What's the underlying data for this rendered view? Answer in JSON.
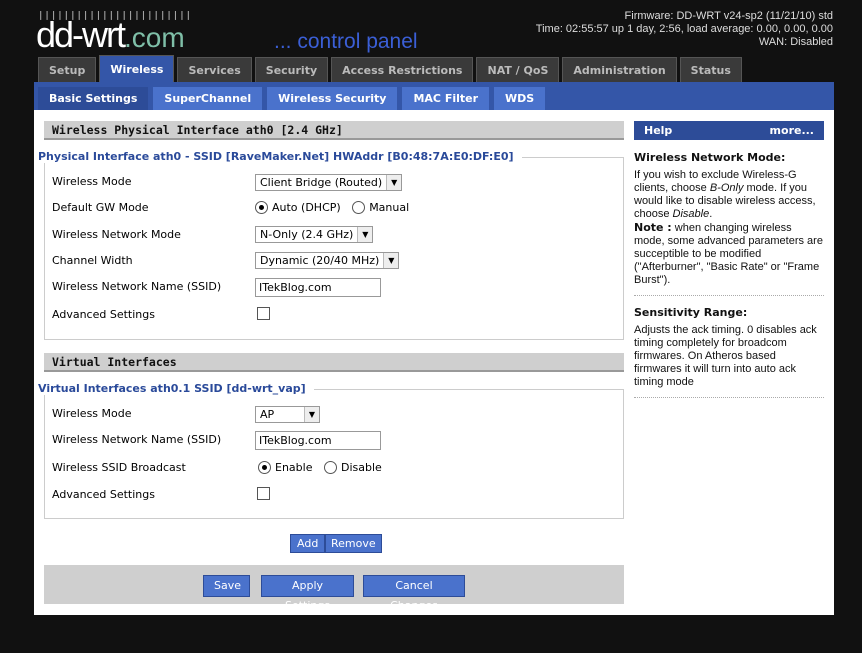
{
  "header": {
    "logo": "dd-wrt",
    "logo_com": ".com",
    "subtitle": "... control panel",
    "firmware": "Firmware: DD-WRT v24-sp2 (11/21/10) std",
    "time": "Time: 02:55:57 up 1 day, 2:56, load average: 0.00, 0.00, 0.00",
    "wan": "WAN: Disabled"
  },
  "tabs": [
    "Setup",
    "Wireless",
    "Services",
    "Security",
    "Access Restrictions",
    "NAT / QoS",
    "Administration",
    "Status"
  ],
  "active_tab": "Wireless",
  "subtabs": [
    "Basic Settings",
    "SuperChannel",
    "Wireless Security",
    "MAC Filter",
    "WDS"
  ],
  "physical": {
    "section_title": "Wireless Physical Interface ath0 [2.4 GHz]",
    "legend": "Physical Interface ath0 - SSID [RaveMaker.Net] HWAddr [B0:48:7A:E0:DF:E0]",
    "wireless_mode_label": "Wireless Mode",
    "wireless_mode": "Client Bridge (Routed)",
    "gw_label": "Default GW Mode",
    "gw_auto": "Auto (DHCP)",
    "gw_manual": "Manual",
    "net_mode_label": "Wireless Network Mode",
    "net_mode": "N-Only (2.4 GHz)",
    "width_label": "Channel Width",
    "width": "Dynamic (20/40 MHz)",
    "ssid_label": "Wireless Network Name (SSID)",
    "ssid": "ITekBlog.com",
    "adv_label": "Advanced Settings"
  },
  "virtual": {
    "section_title": "Virtual Interfaces",
    "legend": "Virtual Interfaces ath0.1 SSID [dd-wrt_vap]",
    "wireless_mode_label": "Wireless Mode",
    "wireless_mode": "AP",
    "ssid_label": "Wireless Network Name (SSID)",
    "ssid": "ITekBlog.com",
    "broadcast_label": "Wireless SSID Broadcast",
    "enable": "Enable",
    "disable": "Disable",
    "adv_label": "Advanced Settings",
    "add": "Add",
    "remove": "Remove"
  },
  "actions": {
    "save": "Save",
    "apply": "Apply Settings",
    "cancel": "Cancel Changes"
  },
  "help": {
    "title": "Help",
    "more": "more...",
    "h1": "Wireless Network Mode:",
    "p1a": "If you wish to exclude Wireless-G clients, choose ",
    "p1b": "B-Only",
    "p1c": " mode. If you would like to disable wireless access, choose ",
    "p1d": "Disable",
    "p1e": ".",
    "note": "Note :",
    "note_text": " when changing wireless mode, some advanced parameters are succeptible to be modified (\"Afterburner\", \"Basic Rate\" or \"Frame Burst\").",
    "h2": "Sensitivity Range:",
    "p2": "Adjusts the ack timing. 0 disables ack timing completely for broadcom firmwares. On Atheros based firmwares it will turn into auto ack timing mode"
  }
}
